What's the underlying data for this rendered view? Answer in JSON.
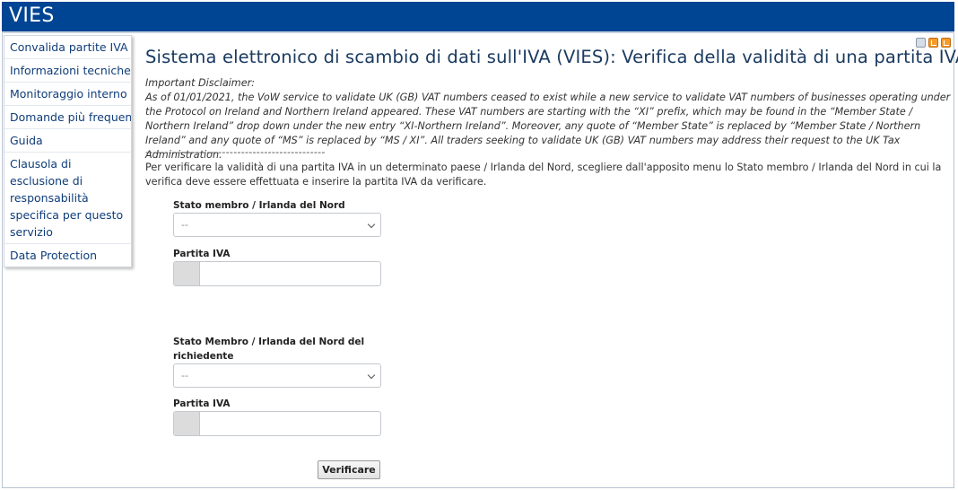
{
  "app": {
    "title": "VIES"
  },
  "sidebar": {
    "items": [
      {
        "label": "Convalida partite IVA"
      },
      {
        "label": "Informazioni tecniche"
      },
      {
        "label": "Monitoraggio interno"
      },
      {
        "label": "Domande più frequenti"
      },
      {
        "label": "Guida"
      },
      {
        "label": "Clausola di esclusione di responsabilità specifica per questo servizio"
      },
      {
        "label": "Data Protection"
      }
    ]
  },
  "toolbar": {
    "icons": [
      "print-icon",
      "rss-icon",
      "rss-icon"
    ]
  },
  "main": {
    "title": "Sistema elettronico di scambio di dati sull'IVA (VIES): Verifica della validità di una partita IVA",
    "disclaimer_heading": "Important Disclaimer:",
    "disclaimer_text": "As of 01/01/2021, the VoW service to validate UK (GB) VAT numbers ceased to exist while a new service to validate VAT numbers of businesses operating under the Protocol on Ireland and Northern Ireland appeared. These VAT numbers are starting with the “XI” prefix, which may be found in the “Member State / Northern Ireland” drop down under the new entry “XI-Northern Ireland”. Moreover, any quote of “Member State” is replaced by “Member State / Northern Ireland” and any quote of “MS” is replaced by “MS / XI”. All traders seeking to validate UK (GB) VAT numbers may address their request to the UK Tax Administration.",
    "separator": "-----------------------------------------------",
    "instruction": "Per verificare la validità di una partita IVA in un determinato paese / Irlanda del Nord, scegliere dall'apposito menu lo Stato membro / Irlanda del Nord in cui la verifica deve essere effettuata e inserire la partita IVA da verificare."
  },
  "form": {
    "member_state_label": "Stato membro / Irlanda del Nord",
    "member_state_value": "--",
    "vat_label": "Partita IVA",
    "vat_value": "",
    "requester_state_label_line1": "Stato Membro / Irlanda del Nord del",
    "requester_state_label_line2": "richiedente",
    "requester_state_value": "--",
    "requester_vat_label": "Partita IVA",
    "requester_vat_value": "",
    "submit_label": "Verificare"
  }
}
